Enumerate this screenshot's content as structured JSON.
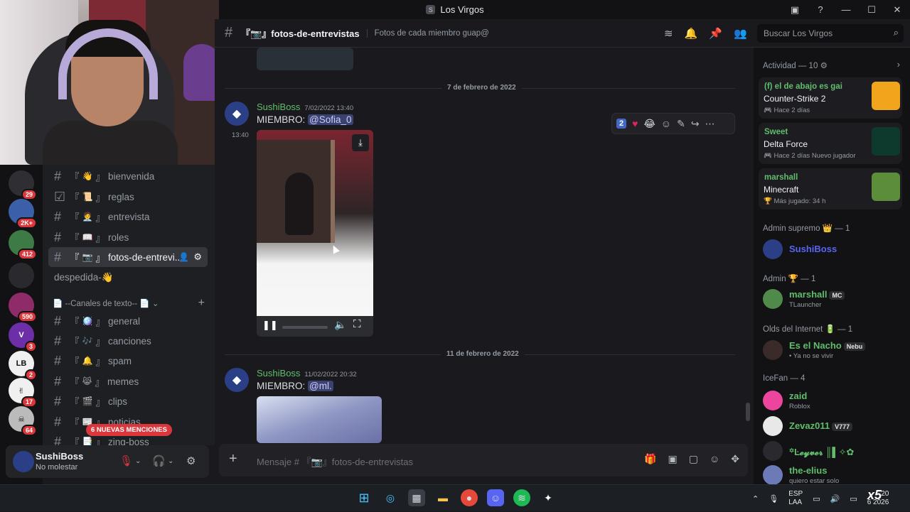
{
  "window": {
    "title": "Los Virgos",
    "server_icon": "S"
  },
  "server_badges": [
    {
      "icon": "",
      "count": "29",
      "color": "#2f2f33"
    },
    {
      "icon": "",
      "count": "2K+",
      "color": "#3b5fa8"
    },
    {
      "icon": "",
      "count": "412",
      "color": "#3e7a45"
    },
    {
      "icon": "",
      "count": "",
      "color": "#2a2a2e"
    },
    {
      "icon": "",
      "count": "590",
      "color": "#8e2c6a"
    },
    {
      "icon": "V",
      "count": "3",
      "color": "#6d2fa8"
    },
    {
      "icon": "LB",
      "count": "2",
      "color": "#f0f0f0"
    },
    {
      "icon": "✌",
      "count": "17",
      "color": "#f0f0f0"
    },
    {
      "icon": "☠",
      "count": "64",
      "color": "#bbbbbb"
    }
  ],
  "channels": [
    {
      "emoji": "👋",
      "name": "bienvenida",
      "prefix": "#"
    },
    {
      "emoji": "📜",
      "name": "reglas",
      "prefix": "☑"
    },
    {
      "emoji": "🧑‍💼",
      "name": "entrevista",
      "prefix": "#"
    },
    {
      "emoji": "📖",
      "name": "roles",
      "prefix": "#"
    },
    {
      "emoji": "📷",
      "name": "fotos-de-entrevi...",
      "prefix": "#"
    },
    {
      "emoji": "",
      "name": "despedida-👋",
      "prefix": ""
    }
  ],
  "text_category": "📄 --Canales de texto-- 📄",
  "text_channels": [
    {
      "emoji": "🪩",
      "name": "general"
    },
    {
      "emoji": "🎶",
      "name": "canciones"
    },
    {
      "emoji": "🔔",
      "name": "spam"
    },
    {
      "emoji": "😹",
      "name": "memes"
    },
    {
      "emoji": "🎬",
      "name": "clips"
    },
    {
      "emoji": "📰",
      "name": "noticias"
    },
    {
      "emoji": "📑",
      "name": "zing-boss"
    }
  ],
  "mentions_label": "6 NUEVAS MENCIONES",
  "user": {
    "name": "SushiBoss",
    "status": "No molestar"
  },
  "header": {
    "channel": "『📷』fotos-de-entrevistas",
    "topic": "Fotos de cada miembro guap@",
    "search_placeholder": "Buscar Los Virgos"
  },
  "date_dividers": [
    "7 de febrero de 2022",
    "11 de febrero de 2022"
  ],
  "messages": [
    {
      "author": "SushiBoss",
      "timestamp": "7/02/2022 13:40",
      "hover_time": "13:40",
      "prefix": "MIEMBRO: ",
      "mention": "@Sofia_0"
    },
    {
      "author": "SushiBoss",
      "timestamp": "11/02/2022 20:32",
      "prefix": "MIEMBRO: ",
      "mention": "@ml."
    }
  ],
  "reaction_count": "2",
  "composer_placeholder": "Mensaje # 『📷』fotos-de-entrevistas",
  "activity": {
    "header": "Actividad — 10",
    "cards": [
      {
        "user": "(f) el de abajo es gai",
        "game": "Counter-Strike 2",
        "meta": "Hace 2 días"
      },
      {
        "user": "Sweet",
        "game": "Delta Force",
        "meta": "Hace 2 días",
        "extra": "Nuevo jugador"
      },
      {
        "user": "marshall",
        "game": "Minecraft",
        "meta": "Más jugado: 34 h"
      }
    ]
  },
  "member_groups": [
    {
      "label": "Admin supremo 👑 — 1",
      "members": [
        {
          "name": "SushiBoss",
          "sub": "",
          "tag": ""
        }
      ]
    },
    {
      "label": "Admin 🏆 — 1",
      "members": [
        {
          "name": "marshall",
          "sub": "TLauncher",
          "tag": "MC"
        }
      ]
    },
    {
      "label": "Olds del Internet 🔋 — 1",
      "members": [
        {
          "name": "Es el Nacho",
          "sub": "• Ya no se vivir",
          "tag": "Nebu"
        }
      ]
    },
    {
      "label": "IceFan — 4",
      "members": [
        {
          "name": "zaid",
          "sub": "Roblox",
          "tag": ""
        },
        {
          "name": "Zevaz011",
          "sub": "",
          "tag": "V777"
        },
        {
          "name": "꙳Ŀ𝓮𝔂𝓿𝓮𝓻 ║▌✧✿",
          "sub": "",
          "tag": ""
        },
        {
          "name": "the-elius",
          "sub": "quiero estar solo",
          "tag": ""
        }
      ]
    }
  ],
  "taskbar": {
    "lang": "ESP",
    "lang2": "LAA",
    "time": "20",
    "date": "6 2026",
    "overlay": "x5"
  }
}
